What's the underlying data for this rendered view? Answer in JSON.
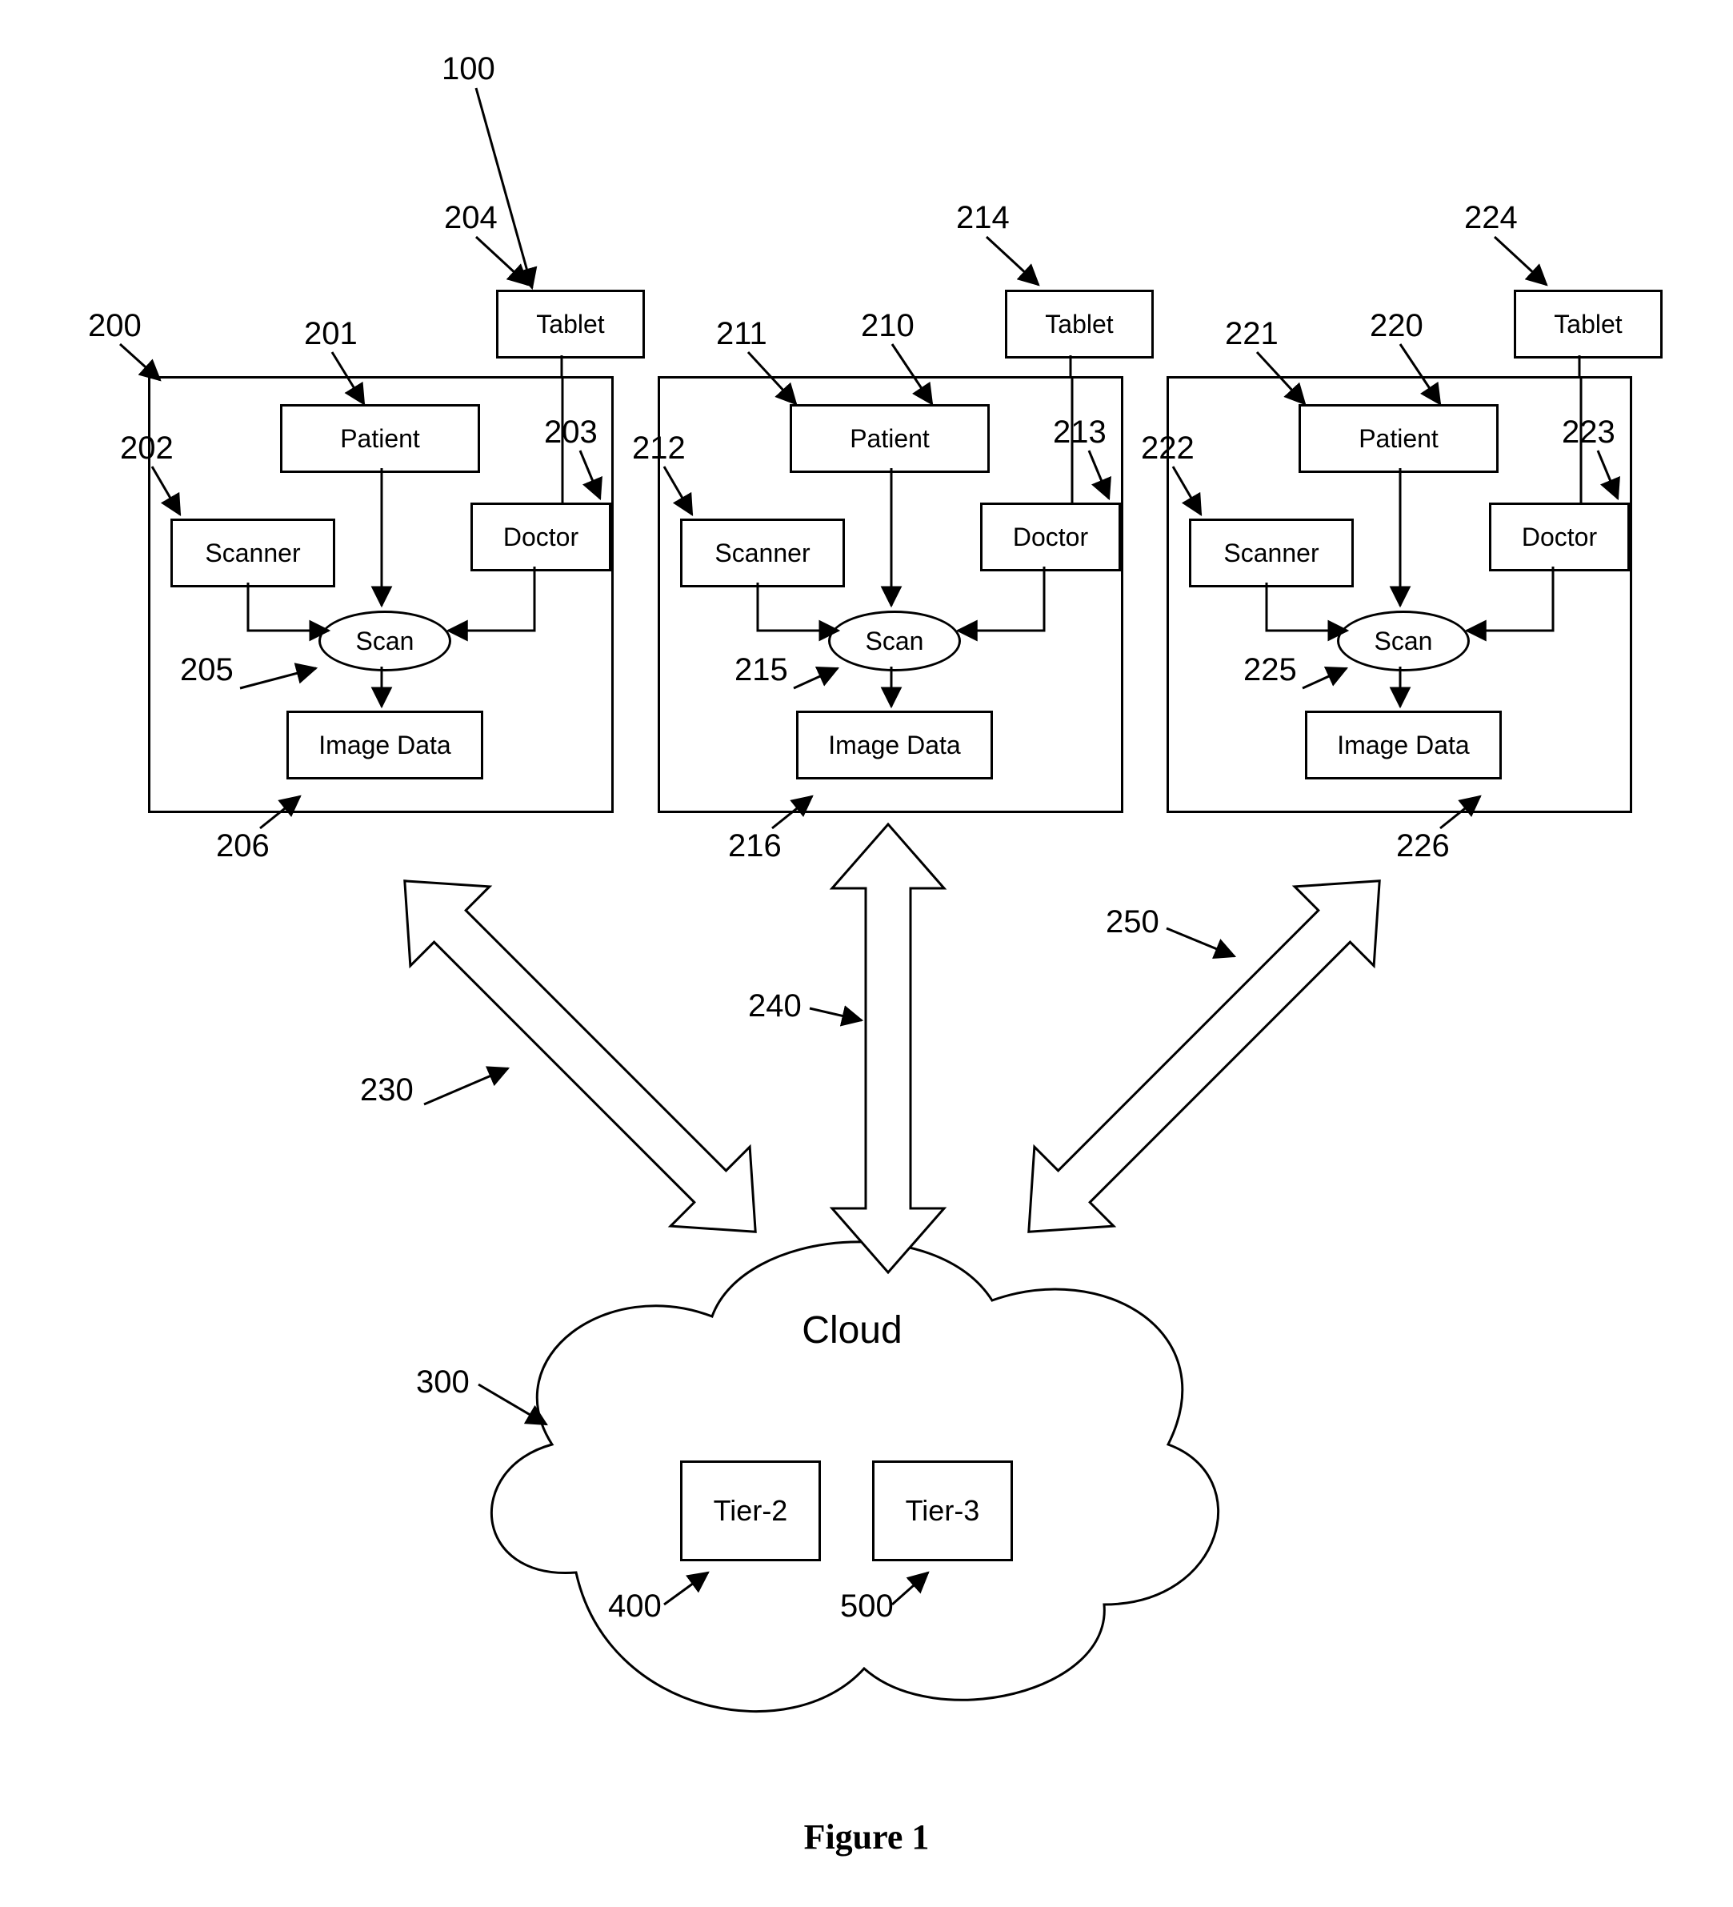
{
  "figure_caption": "Figure 1",
  "siteA": {
    "patient": "Patient",
    "scanner": "Scanner",
    "doctor": "Doctor",
    "scan": "Scan",
    "image_data": "Image Data",
    "tablet": "Tablet"
  },
  "siteB": {
    "patient": "Patient",
    "scanner": "Scanner",
    "doctor": "Doctor",
    "scan": "Scan",
    "image_data": "Image Data",
    "tablet": "Tablet"
  },
  "siteC": {
    "patient": "Patient",
    "scanner": "Scanner",
    "doctor": "Doctor",
    "scan": "Scan",
    "image_data": "Image Data",
    "tablet": "Tablet"
  },
  "cloud": {
    "label": "Cloud",
    "tier2": "Tier-2",
    "tier3": "Tier-3"
  },
  "refs": {
    "r100": "100",
    "r200": "200",
    "r201": "201",
    "r202": "202",
    "r203": "203",
    "r204": "204",
    "r205": "205",
    "r206": "206",
    "r210": "210",
    "r211": "211",
    "r212": "212",
    "r213": "213",
    "r214": "214",
    "r215": "215",
    "r216": "216",
    "r220": "220",
    "r221": "221",
    "r222": "222",
    "r223": "223",
    "r224": "224",
    "r225": "225",
    "r226": "226",
    "r230": "230",
    "r240": "240",
    "r250": "250",
    "r300": "300",
    "r400": "400",
    "r500": "500"
  }
}
